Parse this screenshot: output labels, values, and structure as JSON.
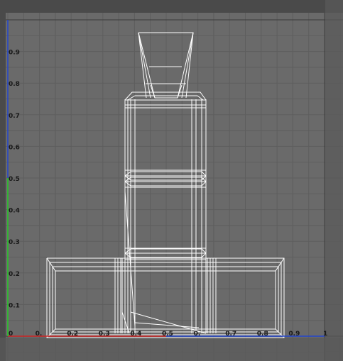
{
  "viewport": {
    "name": "UV texture editor",
    "grid": true,
    "background": "#6a6a6a",
    "border_color": "#505050",
    "grid_color": "#5e5e5e",
    "axis_colors": {
      "u": "#cc2222",
      "u_extra": "#2244cc",
      "v": "#22cc22",
      "v_extra": "#2244cc"
    },
    "wire_color": "#ffffff",
    "v_labels": [
      "0.9",
      "0.8",
      "0.7",
      "0.6",
      "0.5",
      "0.4",
      "0.3",
      "0.2",
      "0.1"
    ],
    "u_labels": [
      "0",
      "0.",
      "0.2",
      "0.3",
      "0.4",
      "0.5",
      "0.",
      "0.7",
      "0.8",
      "0.9"
    ],
    "origin_label": "0",
    "u_end_label": "1"
  }
}
